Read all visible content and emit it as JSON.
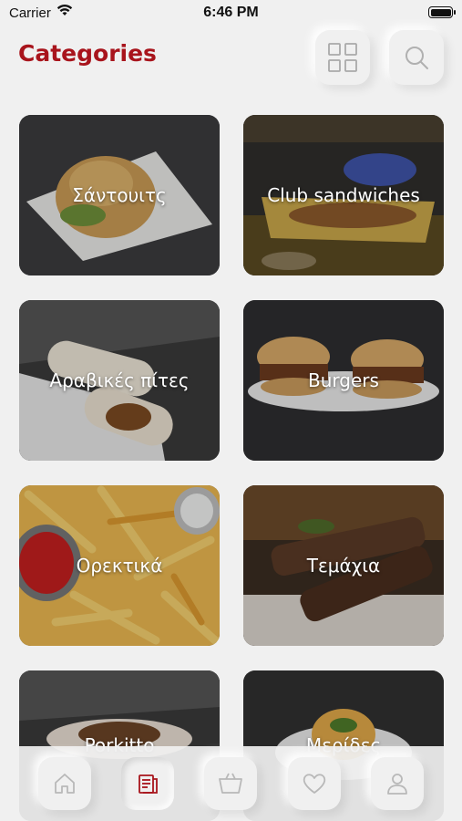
{
  "status_bar": {
    "carrier": "Carrier",
    "time": "6:46 PM",
    "icons": [
      "wifi-icon",
      "battery-icon"
    ]
  },
  "header": {
    "title": "Categories",
    "title_color": "#a8141c",
    "actions": [
      "grid-icon",
      "search-icon"
    ]
  },
  "categories": [
    {
      "label": "Σάντουιτς"
    },
    {
      "label": "Club sandwiches"
    },
    {
      "label": "Αραβικές πίτες"
    },
    {
      "label": "Burgers"
    },
    {
      "label": "Ορεκτικά"
    },
    {
      "label": "Τεμάχια"
    },
    {
      "label": "Porkitto"
    },
    {
      "label": "Μερίδες"
    }
  ],
  "tab_bar": {
    "tabs": [
      {
        "icon": "home-icon",
        "active": false
      },
      {
        "icon": "menu-list-icon",
        "active": true
      },
      {
        "icon": "basket-icon",
        "active": false
      },
      {
        "icon": "heart-icon",
        "active": false
      },
      {
        "icon": "profile-icon",
        "active": false
      }
    ],
    "active_color": "#a8141c",
    "inactive_color": "#b8b8b8"
  }
}
